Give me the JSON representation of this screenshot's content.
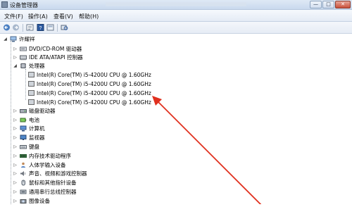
{
  "window": {
    "title": "设备管理器",
    "buttons": {
      "minimize": "—",
      "maximize": "□",
      "close": "✕"
    }
  },
  "menu": {
    "items": [
      "文件(F)",
      "操作(A)",
      "查看(V)",
      "帮助(H)"
    ]
  },
  "toolbar": {
    "icons": [
      "back-icon",
      "forward-icon",
      "properties-icon",
      "help-icon",
      "scan-hardware-icon"
    ]
  },
  "tree": {
    "root": "许耀祥",
    "nodes": [
      {
        "label": "DVD/CD-ROM 驱动器",
        "icon": "dvd-drive-icon",
        "expanded": false
      },
      {
        "label": "IDE ATA/ATAPI 控制器",
        "icon": "ide-controller-icon",
        "expanded": false
      },
      {
        "label": "处理器",
        "icon": "processor-icon",
        "expanded": true,
        "children": [
          "Intel(R) Core(TM) i5-4200U CPU @ 1.60GHz",
          "Intel(R) Core(TM) i5-4200U CPU @ 1.60GHz",
          "Intel(R) Core(TM) i5-4200U CPU @ 1.60GHz",
          "Intel(R) Core(TM) i5-4200U CPU @ 1.60GHz"
        ]
      },
      {
        "label": "磁盘驱动器",
        "icon": "disk-drive-icon",
        "expanded": false
      },
      {
        "label": "电池",
        "icon": "battery-icon",
        "expanded": false
      },
      {
        "label": "计算机",
        "icon": "computer-icon",
        "expanded": false
      },
      {
        "label": "监视器",
        "icon": "monitor-icon",
        "expanded": false
      },
      {
        "label": "键盘",
        "icon": "keyboard-icon",
        "expanded": false
      },
      {
        "label": "内存技术驱动程序",
        "icon": "memory-icon",
        "expanded": false
      },
      {
        "label": "人体学输入设备",
        "icon": "hid-icon",
        "expanded": false
      },
      {
        "label": "声音、视频和游戏控制器",
        "icon": "sound-icon",
        "expanded": false
      },
      {
        "label": "鼠标和其他指针设备",
        "icon": "mouse-icon",
        "expanded": false
      },
      {
        "label": "通用串行总线控制器",
        "icon": "usb-icon",
        "expanded": false
      },
      {
        "label": "图像设备",
        "icon": "camera-icon",
        "expanded": false
      }
    ]
  },
  "colors": {
    "annotation_arrow": "#e0301e"
  }
}
